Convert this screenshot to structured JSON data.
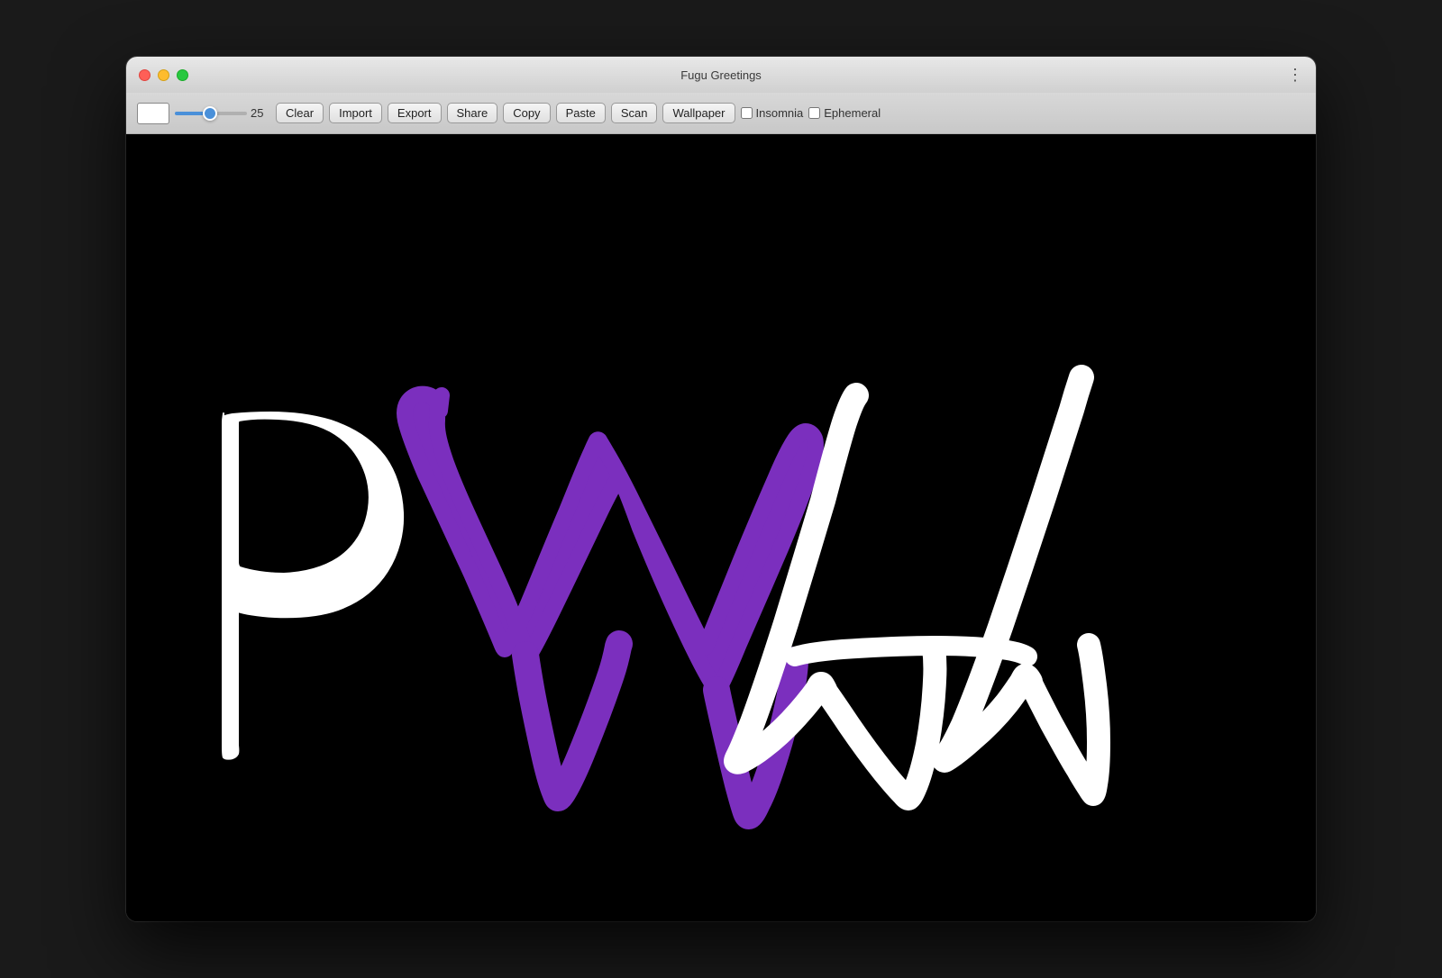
{
  "window": {
    "title": "Fugu Greetings"
  },
  "toolbar": {
    "color_swatch_value": "#ffffff",
    "slider_value": 25,
    "buttons": [
      {
        "id": "clear",
        "label": "Clear"
      },
      {
        "id": "import",
        "label": "Import"
      },
      {
        "id": "export",
        "label": "Export"
      },
      {
        "id": "share",
        "label": "Share"
      },
      {
        "id": "copy",
        "label": "Copy"
      },
      {
        "id": "paste",
        "label": "Paste"
      },
      {
        "id": "scan",
        "label": "Scan"
      },
      {
        "id": "wallpaper",
        "label": "Wallpaper"
      }
    ],
    "checkboxes": [
      {
        "id": "insomnia",
        "label": "Insomnia",
        "checked": false
      },
      {
        "id": "ephemeral",
        "label": "Ephemeral",
        "checked": false
      }
    ]
  },
  "menu_icon": "⋮",
  "canvas": {
    "background": "#000000"
  }
}
